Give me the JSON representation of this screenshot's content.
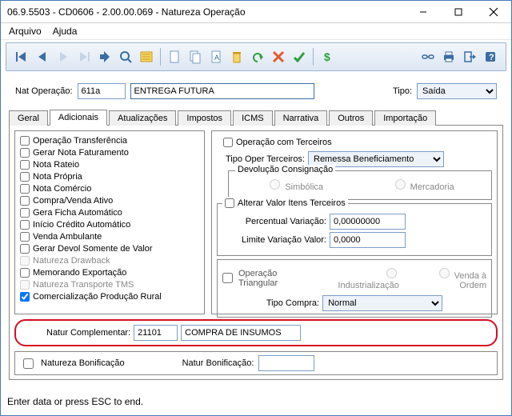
{
  "window": {
    "title": "06.9.5503 - CD0606 - 2.00.00.069 - Natureza Operação"
  },
  "menu": {
    "arquivo": "Arquivo",
    "ajuda": "Ajuda"
  },
  "topform": {
    "nat_label": "Nat Operação:",
    "nat_code": "611a",
    "nat_desc": "ENTREGA FUTURA",
    "tipo_label": "Tipo:",
    "tipo_value": "Saída"
  },
  "tabs": {
    "geral": "Geral",
    "adicionais": "Adicionais",
    "atualizacoes": "Atualizações",
    "impostos": "Impostos",
    "icms": "ICMS",
    "narrativa": "Narrativa",
    "outros": "Outros",
    "importacao": "Importação"
  },
  "left_checks": [
    "Operação Transferência",
    "Gerar Nota Faturamento",
    "Nota Rateio",
    "Nota Própria",
    "Nota Comércio",
    "Compra/Venda Ativo",
    "Gera Ficha Automático",
    "Início Crédito Automático",
    "Venda Ambulante",
    "Gerar Devol Somente de Valor",
    "Natureza Drawback",
    "Memorando Exportação",
    "Natureza Transporte TMS",
    "Comercialização Produção Rural"
  ],
  "right": {
    "op_terceiros": "Operação com Terceiros",
    "tipo_oper_label": "Tipo Oper Terceiros:",
    "tipo_oper_value": "Remessa Beneficiamento",
    "dev_consig_legend": "Devolução Consignação",
    "simbolica": "Simbólica",
    "mercadoria": "Mercadoria",
    "alt_valor": "Alterar Valor Itens Terceiros",
    "perc_label": "Percentual Variação:",
    "perc_value": "0,00000000",
    "lim_label": "Limite Variação Valor:",
    "lim_value": "0,0000",
    "op_triang": "Operação Triangular",
    "industr": "Industrialização",
    "venda_ordem": "Venda à Ordem",
    "tipo_compra_label": "Tipo Compra:",
    "tipo_compra_value": "Normal"
  },
  "natcomp": {
    "label": "Natur Complementar:",
    "code": "21101",
    "desc": "COMPRA DE INSUMOS"
  },
  "bonif": {
    "chk_label": "Natureza Bonificação",
    "field_label": "Natur Bonificação:",
    "value": ""
  },
  "status": {
    "text": "Enter data or press ESC to end."
  }
}
